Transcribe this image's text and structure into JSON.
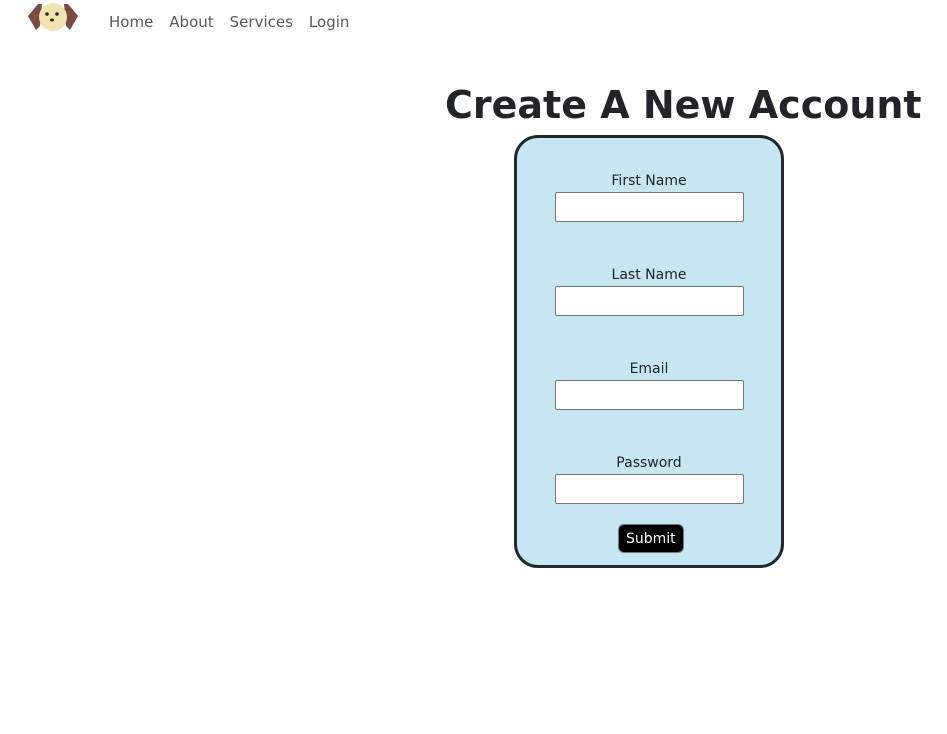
{
  "nav": {
    "logo_icon": "dog-face-icon",
    "links": [
      {
        "label": "Home"
      },
      {
        "label": "About"
      },
      {
        "label": "Services"
      },
      {
        "label": "Login"
      }
    ]
  },
  "main": {
    "title": "Create A New Account",
    "form": {
      "fields": [
        {
          "label": "First Name",
          "value": ""
        },
        {
          "label": "Last Name",
          "value": ""
        },
        {
          "label": "Email",
          "value": ""
        },
        {
          "label": "Password",
          "value": ""
        }
      ],
      "submit_label": "Submit"
    }
  },
  "colors": {
    "card_background": "#c6e7f1",
    "card_border": "#23272b",
    "button_background": "#000000",
    "logo_ear": "#7a4a45",
    "logo_face": "#f3e3b0"
  }
}
